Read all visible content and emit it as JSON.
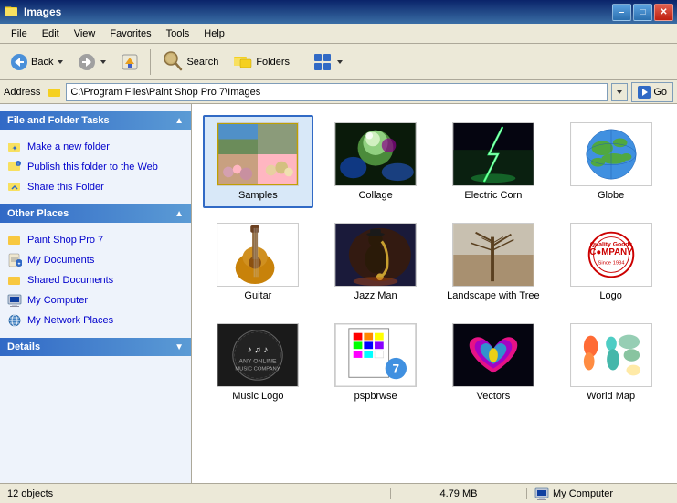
{
  "titleBar": {
    "icon": "folder",
    "title": "Images",
    "minimizeLabel": "–",
    "maximizeLabel": "□",
    "closeLabel": "✕"
  },
  "menuBar": {
    "items": [
      "File",
      "Edit",
      "View",
      "Favorites",
      "Tools",
      "Help"
    ]
  },
  "toolbar": {
    "backLabel": "Back",
    "forwardLabel": "",
    "upLabel": "",
    "searchLabel": "Search",
    "foldersLabel": "Folders",
    "viewLabel": ""
  },
  "addressBar": {
    "label": "Address",
    "value": "C:\\Program Files\\Paint Shop Pro 7\\Images",
    "goLabel": "Go"
  },
  "leftPanel": {
    "sections": [
      {
        "id": "file-folder-tasks",
        "header": "File and Folder Tasks",
        "links": [
          {
            "id": "new-folder",
            "label": "Make a new folder",
            "icon": "folder-new"
          },
          {
            "id": "publish-folder",
            "label": "Publish this folder to the Web",
            "icon": "publish"
          },
          {
            "id": "share-folder",
            "label": "Share this Folder",
            "icon": "share"
          }
        ]
      },
      {
        "id": "other-places",
        "header": "Other Places",
        "links": [
          {
            "id": "paint-shop-pro",
            "label": "Paint Shop Pro 7",
            "icon": "folder"
          },
          {
            "id": "my-documents",
            "label": "My Documents",
            "icon": "my-docs"
          },
          {
            "id": "shared-documents",
            "label": "Shared Documents",
            "icon": "folder"
          },
          {
            "id": "my-computer",
            "label": "My Computer",
            "icon": "computer"
          },
          {
            "id": "network-places",
            "label": "My Network Places",
            "icon": "network"
          }
        ]
      },
      {
        "id": "details",
        "header": "Details",
        "links": []
      }
    ]
  },
  "fileGrid": {
    "items": [
      {
        "id": "samples",
        "label": "Samples",
        "thumb": "samples",
        "selected": true
      },
      {
        "id": "collage",
        "label": "Collage",
        "thumb": "collage",
        "selected": false
      },
      {
        "id": "electric-corn",
        "label": "Electric Corn",
        "thumb": "ecorn",
        "selected": false
      },
      {
        "id": "globe",
        "label": "Globe",
        "thumb": "globe",
        "selected": false
      },
      {
        "id": "guitar",
        "label": "Guitar",
        "thumb": "guitar",
        "selected": false
      },
      {
        "id": "jazz-man",
        "label": "Jazz Man",
        "thumb": "jazz",
        "selected": false
      },
      {
        "id": "landscape-tree",
        "label": "Landscape with Tree",
        "thumb": "landscape",
        "selected": false
      },
      {
        "id": "logo",
        "label": "Logo",
        "thumb": "logo",
        "selected": false
      },
      {
        "id": "music-logo",
        "label": "Music Logo",
        "thumb": "musiclogo",
        "selected": false
      },
      {
        "id": "pspbrwse",
        "label": "pspbrwse",
        "thumb": "pspbrwse",
        "selected": false
      },
      {
        "id": "vectors",
        "label": "Vectors",
        "thumb": "vectors",
        "selected": false
      },
      {
        "id": "world-map",
        "label": "World Map",
        "thumb": "worldmap",
        "selected": false
      }
    ]
  },
  "statusBar": {
    "objectCount": "12 objects",
    "fileSize": "4.79 MB",
    "computer": "My Computer"
  }
}
